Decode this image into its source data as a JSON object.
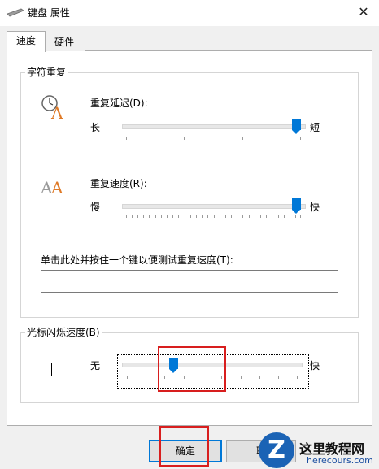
{
  "window": {
    "title": "键盘 属性",
    "close_glyph": "✕"
  },
  "tabs": [
    {
      "label": "速度",
      "selected": true
    },
    {
      "label": "硬件",
      "selected": false
    }
  ],
  "char_repeat": {
    "legend": "字符重复",
    "delay": {
      "label": "重复延迟(D):",
      "left_label": "长",
      "right_label": "短",
      "value_fraction": 1.0
    },
    "rate": {
      "label": "重复速度(R):",
      "left_label": "慢",
      "right_label": "快",
      "value_fraction": 1.0
    },
    "test_label": "单击此处并按住一个键以便测试重复速度(T):",
    "test_value": ""
  },
  "cursor_blink": {
    "legend": "光标闪烁速度(B)",
    "left_label": "无",
    "right_label": "快",
    "value_fraction": 0.3
  },
  "buttons": {
    "ok": "确定",
    "cancel": "取"
  },
  "watermark": {
    "title": "这里教程网",
    "url": "herecours.com",
    "logo_letter": "Z"
  },
  "colors": {
    "accent": "#0078d7",
    "highlight_box": "#d81e1e"
  }
}
